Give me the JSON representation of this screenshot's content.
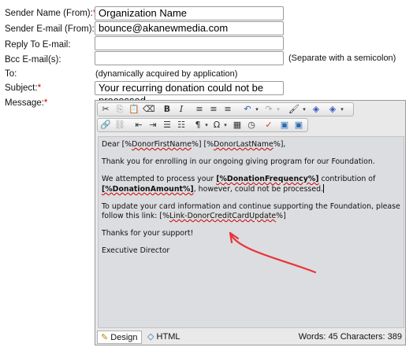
{
  "form": {
    "sender_name": {
      "label": "Sender Name (From):",
      "required_mark": "*",
      "value": "Organization Name"
    },
    "sender_email": {
      "label": "Sender E-mail (From):",
      "required_mark": "*",
      "value": "bounce@akanewmedia.com"
    },
    "reply_to": {
      "label": "Reply To E-mail:",
      "value": ""
    },
    "bcc": {
      "label": "Bcc E-mail(s):",
      "value": "",
      "hint": "(Separate with a semicolon)"
    },
    "to": {
      "label": "To:",
      "value": "(dynamically acquired by application)"
    },
    "subject": {
      "label": "Subject:",
      "required_mark": "*",
      "value": "Your recurring donation could not be processed"
    },
    "message": {
      "label": "Message:",
      "required_mark": "*"
    }
  },
  "editor": {
    "body": {
      "greeting_prefix": "Dear [%",
      "greeting_first": "DonorFirstName",
      "greeting_mid": "%] [%",
      "greeting_last": "DonorLastName",
      "greeting_suffix": "%],",
      "para1": "Thank you for enrolling in our ongoing giving program for our Foundation.",
      "para2_a": "We attempted to process your ",
      "para2_freq": "[%DonationFrequency%]",
      "para2_b": " contribution of ",
      "para2_amt": "[%DonationAmount%]",
      "para2_c": ", however, could not be processed.",
      "para3_a": "To update your card information and continue supporting the Foundation, please follow this link: [%",
      "para3_link": "Link-DonorCreditCardUpdate",
      "para3_b": "%]",
      "para4": "Thanks for your support!",
      "para5": "Executive Director"
    },
    "modes": {
      "design": "Design",
      "html": "HTML"
    },
    "counts": "Words: 45  Characters: 389"
  },
  "annotation_arrow_color": "#e8343a"
}
